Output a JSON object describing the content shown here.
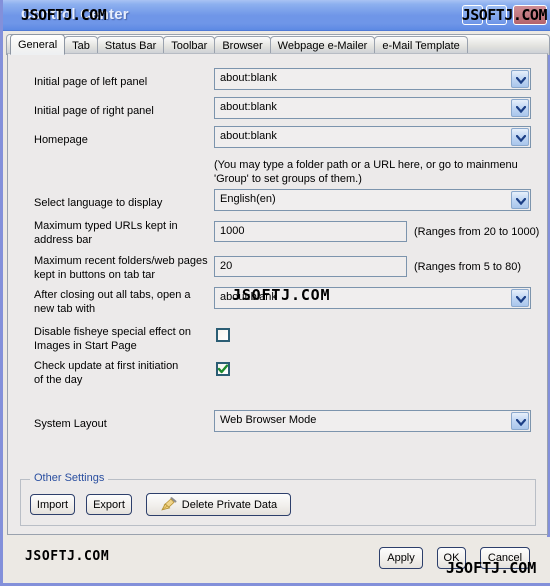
{
  "window": {
    "title": "Control Center",
    "watermarks": {
      "title_left": "JSOFTJ.COM",
      "title_right": "JSOFTJ.COM",
      "middle": "JSOFTJ.COM",
      "bottom_left": "JSOFTJ.COM",
      "bottom_right": "JSOFTJ.COM"
    },
    "controls": {
      "minimize": "minimize-button",
      "maximize": "maximize-button",
      "close": "close-button"
    },
    "accent_color": "#6f96e8",
    "border_color": "#8390da",
    "close_color": "#b4636c"
  },
  "tabs": [
    {
      "label": "General",
      "active": true
    },
    {
      "label": "Tab",
      "active": false
    },
    {
      "label": "Status Bar",
      "active": false
    },
    {
      "label": "Toolbar",
      "active": false
    },
    {
      "label": "Browser",
      "active": false
    },
    {
      "label": "Webpage e-Mailer",
      "active": false
    },
    {
      "label": "e-Mail Template",
      "active": false
    }
  ],
  "general": {
    "fields": [
      {
        "label": "Initial page of left panel",
        "value": "about:blank",
        "type": "combobox"
      },
      {
        "label": "Initial page of right panel",
        "value": "about:blank",
        "type": "combobox"
      },
      {
        "label": "Homepage",
        "value": "about:blank",
        "type": "combobox"
      }
    ],
    "homepage_hint_line1": "(You may type a folder path or a URL here, or go to mainmenu",
    "homepage_hint_line2": "'Group' to set groups of them.)",
    "language": {
      "label": "Select language to display",
      "value": "English(en)"
    },
    "max_urls": {
      "label_line1": "Maximum typed URLs kept in",
      "label_line2": "address bar",
      "value": "1000",
      "range_hint": "(Ranges from 20 to 1000)"
    },
    "max_recent": {
      "label_line1": "Maximum recent folders/web pages",
      "label_line2": "kept in buttons on tab tar",
      "value": "20",
      "range_hint": "(Ranges from 5 to 80)"
    },
    "new_tab": {
      "label_line1": "After closing out all tabs, open a",
      "label_line2": "new tab with",
      "value": "about:blank"
    },
    "disable_fisheye": {
      "label_line1": "Disable fisheye special effect on",
      "label_line2": "Images in Start Page",
      "checked": false
    },
    "check_update": {
      "label_line1": "Check update at first initiation",
      "label_line2": "of the day",
      "checked": true
    },
    "system_layout": {
      "label": "System Layout",
      "value": "Web Browser Mode"
    }
  },
  "other_settings": {
    "title": "Other Settings",
    "import_label": "Import",
    "export_label": "Export",
    "delete_private_data_label": "Delete Private Data",
    "delete_icon": "broom-icon"
  },
  "footer": {
    "apply_label": "Apply",
    "ok_label": "OK",
    "cancel_label": "Cancel"
  }
}
